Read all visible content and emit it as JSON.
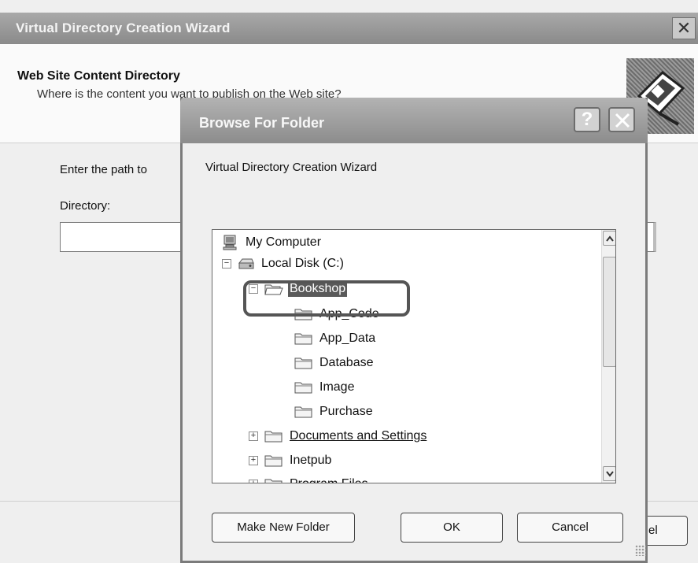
{
  "wizard": {
    "title": "Virtual Directory Creation Wizard",
    "close_glyph": "✕",
    "heading": "Web Site Content Directory",
    "subheading": "Where is the content you want to publish on the Web site?",
    "instruction": "Enter the path to",
    "directory_label": "Directory:",
    "directory_value": "",
    "cancel_label_fragment": "el"
  },
  "dialog": {
    "title": "Browse For Folder",
    "help_glyph": "?",
    "description": "Virtual Directory Creation Wizard",
    "tree": [
      {
        "label": "My Computer",
        "icon": "computer-icon"
      },
      {
        "label": "Local Disk (C:)",
        "icon": "drive-icon",
        "expanded": true
      },
      {
        "label": "Bookshop",
        "icon": "folder-open-icon",
        "expanded": true,
        "selected": true
      },
      {
        "label": "App_Code",
        "icon": "folder-icon"
      },
      {
        "label": "App_Data",
        "icon": "folder-icon"
      },
      {
        "label": "Database",
        "icon": "folder-icon"
      },
      {
        "label": "Image",
        "icon": "folder-icon"
      },
      {
        "label": "Purchase",
        "icon": "folder-icon"
      },
      {
        "label": "Documents and Settings",
        "icon": "folder-icon",
        "expanded": false
      },
      {
        "label": "Inetpub",
        "icon": "folder-icon",
        "expanded": false
      },
      {
        "label": "Program Files",
        "icon": "folder-icon",
        "expanded": false
      }
    ],
    "buttons": {
      "make_new_folder": "Make New Folder",
      "ok": "OK",
      "cancel": "Cancel"
    }
  },
  "colors": {
    "titlebar": "#9a9a9a",
    "selection": "#5a5a5a"
  }
}
